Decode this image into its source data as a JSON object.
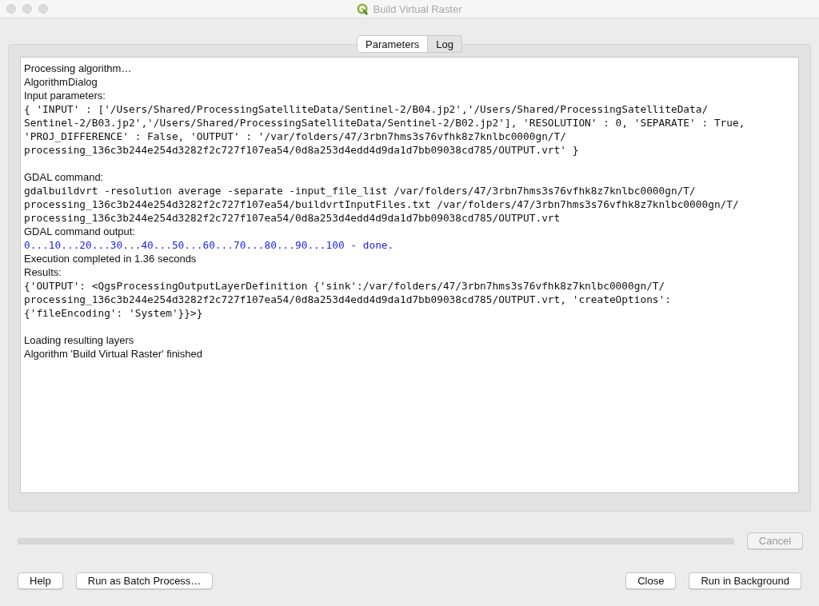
{
  "window": {
    "title": "Build Virtual Raster"
  },
  "tabs": [
    {
      "label": "Parameters",
      "selected": false
    },
    {
      "label": "Log",
      "selected": true
    }
  ],
  "log": [
    {
      "kind": "text",
      "text": "Processing algorithm…"
    },
    {
      "kind": "text",
      "text": "AlgorithmDialog"
    },
    {
      "kind": "text",
      "text": "Input parameters:"
    },
    {
      "kind": "mono",
      "text": "{ 'INPUT' : ['/Users/Shared/ProcessingSatelliteData/Sentinel-2/B04.jp2','/Users/Shared/ProcessingSatelliteData/"
    },
    {
      "kind": "mono",
      "text": "Sentinel-2/B03.jp2','/Users/Shared/ProcessingSatelliteData/Sentinel-2/B02.jp2'], 'RESOLUTION' : 0, 'SEPARATE' : True,"
    },
    {
      "kind": "mono",
      "text": "'PROJ_DIFFERENCE' : False, 'OUTPUT' : '/var/folders/47/3rbn7hms3s76vfhk8z7knlbc0000gn/T/"
    },
    {
      "kind": "mono",
      "text": "processing_136c3b244e254d3282f2c727f107ea54/0d8a253d4edd4d9da1d7bb09038cd785/OUTPUT.vrt' }"
    },
    {
      "kind": "blank"
    },
    {
      "kind": "text",
      "text": "GDAL command:"
    },
    {
      "kind": "mono",
      "text": "gdalbuildvrt -resolution average -separate -input_file_list /var/folders/47/3rbn7hms3s76vfhk8z7knlbc0000gn/T/"
    },
    {
      "kind": "mono",
      "text": "processing_136c3b244e254d3282f2c727f107ea54/buildvrtInputFiles.txt /var/folders/47/3rbn7hms3s76vfhk8z7knlbc0000gn/T/"
    },
    {
      "kind": "mono",
      "text": "processing_136c3b244e254d3282f2c727f107ea54/0d8a253d4edd4d9da1d7bb09038cd785/OUTPUT.vrt"
    },
    {
      "kind": "text",
      "text": "GDAL command output:"
    },
    {
      "kind": "progress",
      "text": "0...10...20...30...40...50...60...70...80...90...100 - done."
    },
    {
      "kind": "text",
      "text": "Execution completed in 1.36 seconds"
    },
    {
      "kind": "text",
      "text": "Results:"
    },
    {
      "kind": "mono",
      "text": "{'OUTPUT': <QgsProcessingOutputLayerDefinition {'sink':/var/folders/47/3rbn7hms3s76vfhk8z7knlbc0000gn/T/"
    },
    {
      "kind": "mono",
      "text": "processing_136c3b244e254d3282f2c727f107ea54/0d8a253d4edd4d9da1d7bb09038cd785/OUTPUT.vrt, 'createOptions':"
    },
    {
      "kind": "mono",
      "text": "{'fileEncoding': 'System'}}>}"
    },
    {
      "kind": "blank"
    },
    {
      "kind": "text",
      "text": "Loading resulting layers"
    },
    {
      "kind": "text",
      "text": "Algorithm 'Build Virtual Raster' finished"
    }
  ],
  "progress": {
    "level": 0
  },
  "cancel_button": {
    "label": "Cancel",
    "disabled": true
  },
  "left_buttons": [
    "Help",
    "Run as Batch Process…"
  ],
  "right_buttons": [
    "Close",
    "Run in Background"
  ]
}
